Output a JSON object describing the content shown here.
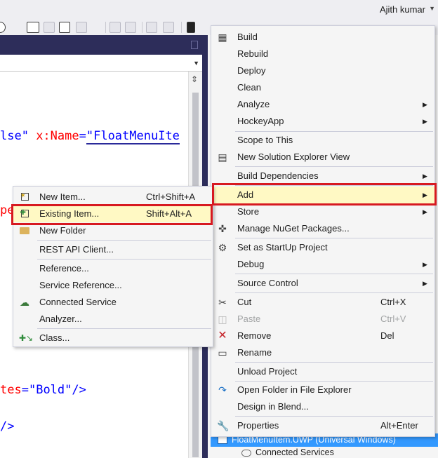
{
  "window": {
    "user_name": "Ajith kumar"
  },
  "editor": {
    "line1_prefix": "lse\" ",
    "line1_attr": "x:Name",
    "line1_eq": "=",
    "line1_val": "\"FloatMenuIte",
    "line2_fragment": "pe",
    "line3_attr": "tes",
    "line3_eq": "=",
    "line3_val": "\"Bold\"",
    "line3_close": "/>",
    "line4_close": "/>"
  },
  "context_menu": {
    "items": [
      {
        "label": "Build",
        "icon": "build-icon"
      },
      {
        "label": "Rebuild"
      },
      {
        "label": "Deploy"
      },
      {
        "label": "Clean"
      },
      {
        "label": "Analyze",
        "submenu": true
      },
      {
        "label": "HockeyApp",
        "submenu": true
      },
      {
        "label": "Scope to This"
      },
      {
        "label": "New Solution Explorer View",
        "icon": "solution-explorer-icon"
      },
      {
        "label": "Build Dependencies",
        "submenu": true
      },
      {
        "label": "Add",
        "submenu": true,
        "highlighted": true
      },
      {
        "label": "Store",
        "submenu": true
      },
      {
        "label": "Manage NuGet Packages...",
        "icon": "nuget-icon"
      },
      {
        "label": "Set as StartUp Project",
        "icon": "gear-icon"
      },
      {
        "label": "Debug",
        "submenu": true
      },
      {
        "label": "Source Control",
        "submenu": true
      },
      {
        "label": "Cut",
        "shortcut": "Ctrl+X",
        "icon": "scissors-icon"
      },
      {
        "label": "Paste",
        "shortcut": "Ctrl+V",
        "icon": "paste-icon",
        "disabled": true
      },
      {
        "label": "Remove",
        "shortcut": "Del",
        "icon": "remove-x-icon"
      },
      {
        "label": "Rename",
        "icon": "rename-icon"
      },
      {
        "label": "Unload Project"
      },
      {
        "label": "Open Folder in File Explorer",
        "icon": "refresh-arrow-icon"
      },
      {
        "label": "Design in Blend..."
      },
      {
        "label": "Properties",
        "shortcut": "Alt+Enter",
        "icon": "wrench-icon"
      }
    ]
  },
  "add_submenu": {
    "items": [
      {
        "label": "New Item...",
        "shortcut": "Ctrl+Shift+A",
        "icon": "new-item-icon"
      },
      {
        "label": "Existing Item...",
        "shortcut": "Shift+Alt+A",
        "icon": "existing-item-icon",
        "highlighted": true
      },
      {
        "label": "New Folder",
        "icon": "new-folder-icon"
      },
      {
        "label": "REST API Client..."
      },
      {
        "label": "Reference..."
      },
      {
        "label": "Service Reference..."
      },
      {
        "label": "Connected Service",
        "icon": "connected-service-icon"
      },
      {
        "label": "Analyzer..."
      },
      {
        "label": "Class...",
        "icon": "class-icon"
      }
    ]
  },
  "solution_explorer": {
    "selected_project": "FloatMenuItem.UWP (Universal Windows)",
    "next_item": "Connected Services"
  },
  "colors": {
    "menu_bg": "#f5f5f5",
    "highlight": "#fff9c4",
    "annotation_red": "#d71920",
    "selection_blue": "#3399ff",
    "xaml_attr": "#ff0000",
    "xaml_value": "#0000ff"
  }
}
